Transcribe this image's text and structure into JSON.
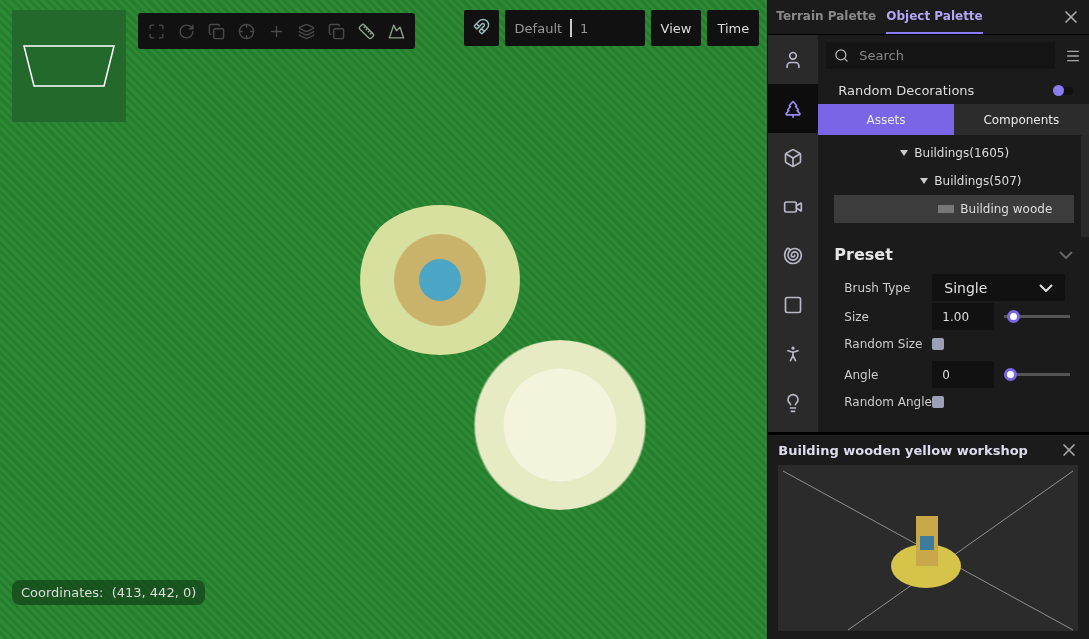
{
  "toolbar": [
    {
      "disabled": true
    },
    {
      "disabled": true
    },
    {
      "disabled": true
    },
    {
      "disabled": true
    },
    {
      "disabled": true
    },
    {
      "disabled": true
    },
    {
      "disabled": true
    },
    {
      "disabled": false
    },
    {
      "disabled": false
    }
  ],
  "layer_field": {
    "value": "Default",
    "index": "1"
  },
  "top_buttons": [
    "View",
    "Time"
  ],
  "coordinates": {
    "label": "Coordinates:",
    "value": "(413, 442, 0)"
  },
  "palette": {
    "tabs": [
      {
        "label": "Terrain Palette",
        "selected": false
      },
      {
        "label": "Object Palette",
        "selected": true
      }
    ],
    "rail": [
      {
        "selected": false
      },
      {
        "selected": true
      },
      {
        "selected": false
      },
      {
        "selected": false
      },
      {
        "selected": false
      },
      {
        "selected": false
      },
      {
        "selected": false
      },
      {
        "selected": false
      }
    ],
    "search": {
      "placeholder": "Search"
    },
    "random_decorations": {
      "label": "Random Decorations",
      "on": false
    },
    "asset_tabs": [
      {
        "label": "Assets",
        "selected": true
      },
      {
        "label": "Components",
        "selected": false
      }
    ],
    "tree": [
      {
        "label": "Buildings(1605)",
        "expanded": true,
        "children": [
          {
            "label": "Buildings(507)",
            "expanded": true,
            "children": [
              {
                "label": "Building woode",
                "selected": true
              }
            ]
          }
        ]
      }
    ],
    "preset": {
      "title": "Preset",
      "expanded": true,
      "rows": [
        {
          "kind": "select",
          "label": "Brush Type",
          "value": "Single"
        },
        {
          "kind": "slider",
          "label": "Size",
          "value": "1.00",
          "level": 0.05
        },
        {
          "kind": "checkbox",
          "label": "Random Size",
          "checked": false
        },
        {
          "kind": "slider",
          "label": "Angle",
          "value": "0",
          "level": 0
        },
        {
          "kind": "checkbox",
          "label": "Random Angle",
          "checked": false
        }
      ]
    }
  },
  "preview": {
    "title": "Building wooden yellow workshop"
  }
}
